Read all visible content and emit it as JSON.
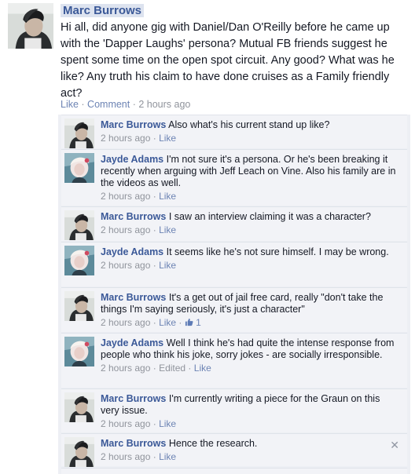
{
  "post": {
    "author": "Marc Burrows",
    "text": "Hi all, did anyone gig with Daniel/Dan O'Reilly before he came up with the 'Dapper Laughs' persona? Mutual FB friends suggest he spent some time on the open spot circuit. Any good? What was he like? Any truth his claim to have done cruises as a Family friendly act?",
    "actions": {
      "like": "Like",
      "sep1": " · ",
      "comment": "Comment",
      "sep2": " · ",
      "time": "2 hours ago"
    }
  },
  "comments": [
    {
      "author": "Marc Burrows",
      "text": "Also what's his current stand up like?",
      "time": "2 hours ago",
      "like": "Like"
    },
    {
      "author": "Jayde Adams",
      "text": "I'm not sure it's a persona. Or he's been breaking it recently when arguing with Jeff Leach on Vine. Also his family are in the videos as well.",
      "time": "2 hours ago",
      "like": "Like"
    },
    {
      "author": "Marc Burrows",
      "text": "I saw an interview claiming it was a character?",
      "time": "2 hours ago",
      "like": "Like"
    },
    {
      "author": "Jayde Adams",
      "text": "It seems like he's not sure himself. I may be wrong.",
      "time": "2 hours ago",
      "like": "Like"
    },
    {
      "author": "Marc Burrows",
      "text": "It's a get out of jail free card, really \"don't take the things I'm saying seriously, it's just a character\"",
      "time": "2 hours ago",
      "like": "Like",
      "likes_count": "1"
    },
    {
      "author": "Jayde Adams",
      "text": "Well I think he's had quite the intense response from people who think his joke, sorry jokes - are socially irresponsible.",
      "time": "2 hours ago",
      "edited": "Edited",
      "like": "Like"
    },
    {
      "author": "Marc Burrows",
      "text": "I'm currently writing a piece for the Graun on this very issue.",
      "time": "2 hours ago",
      "like": "Like"
    },
    {
      "author": "Marc Burrows",
      "text": "Hence the research.",
      "time": "2 hours ago",
      "like": "Like"
    }
  ],
  "sep": " · ",
  "close_symbol": "✕"
}
